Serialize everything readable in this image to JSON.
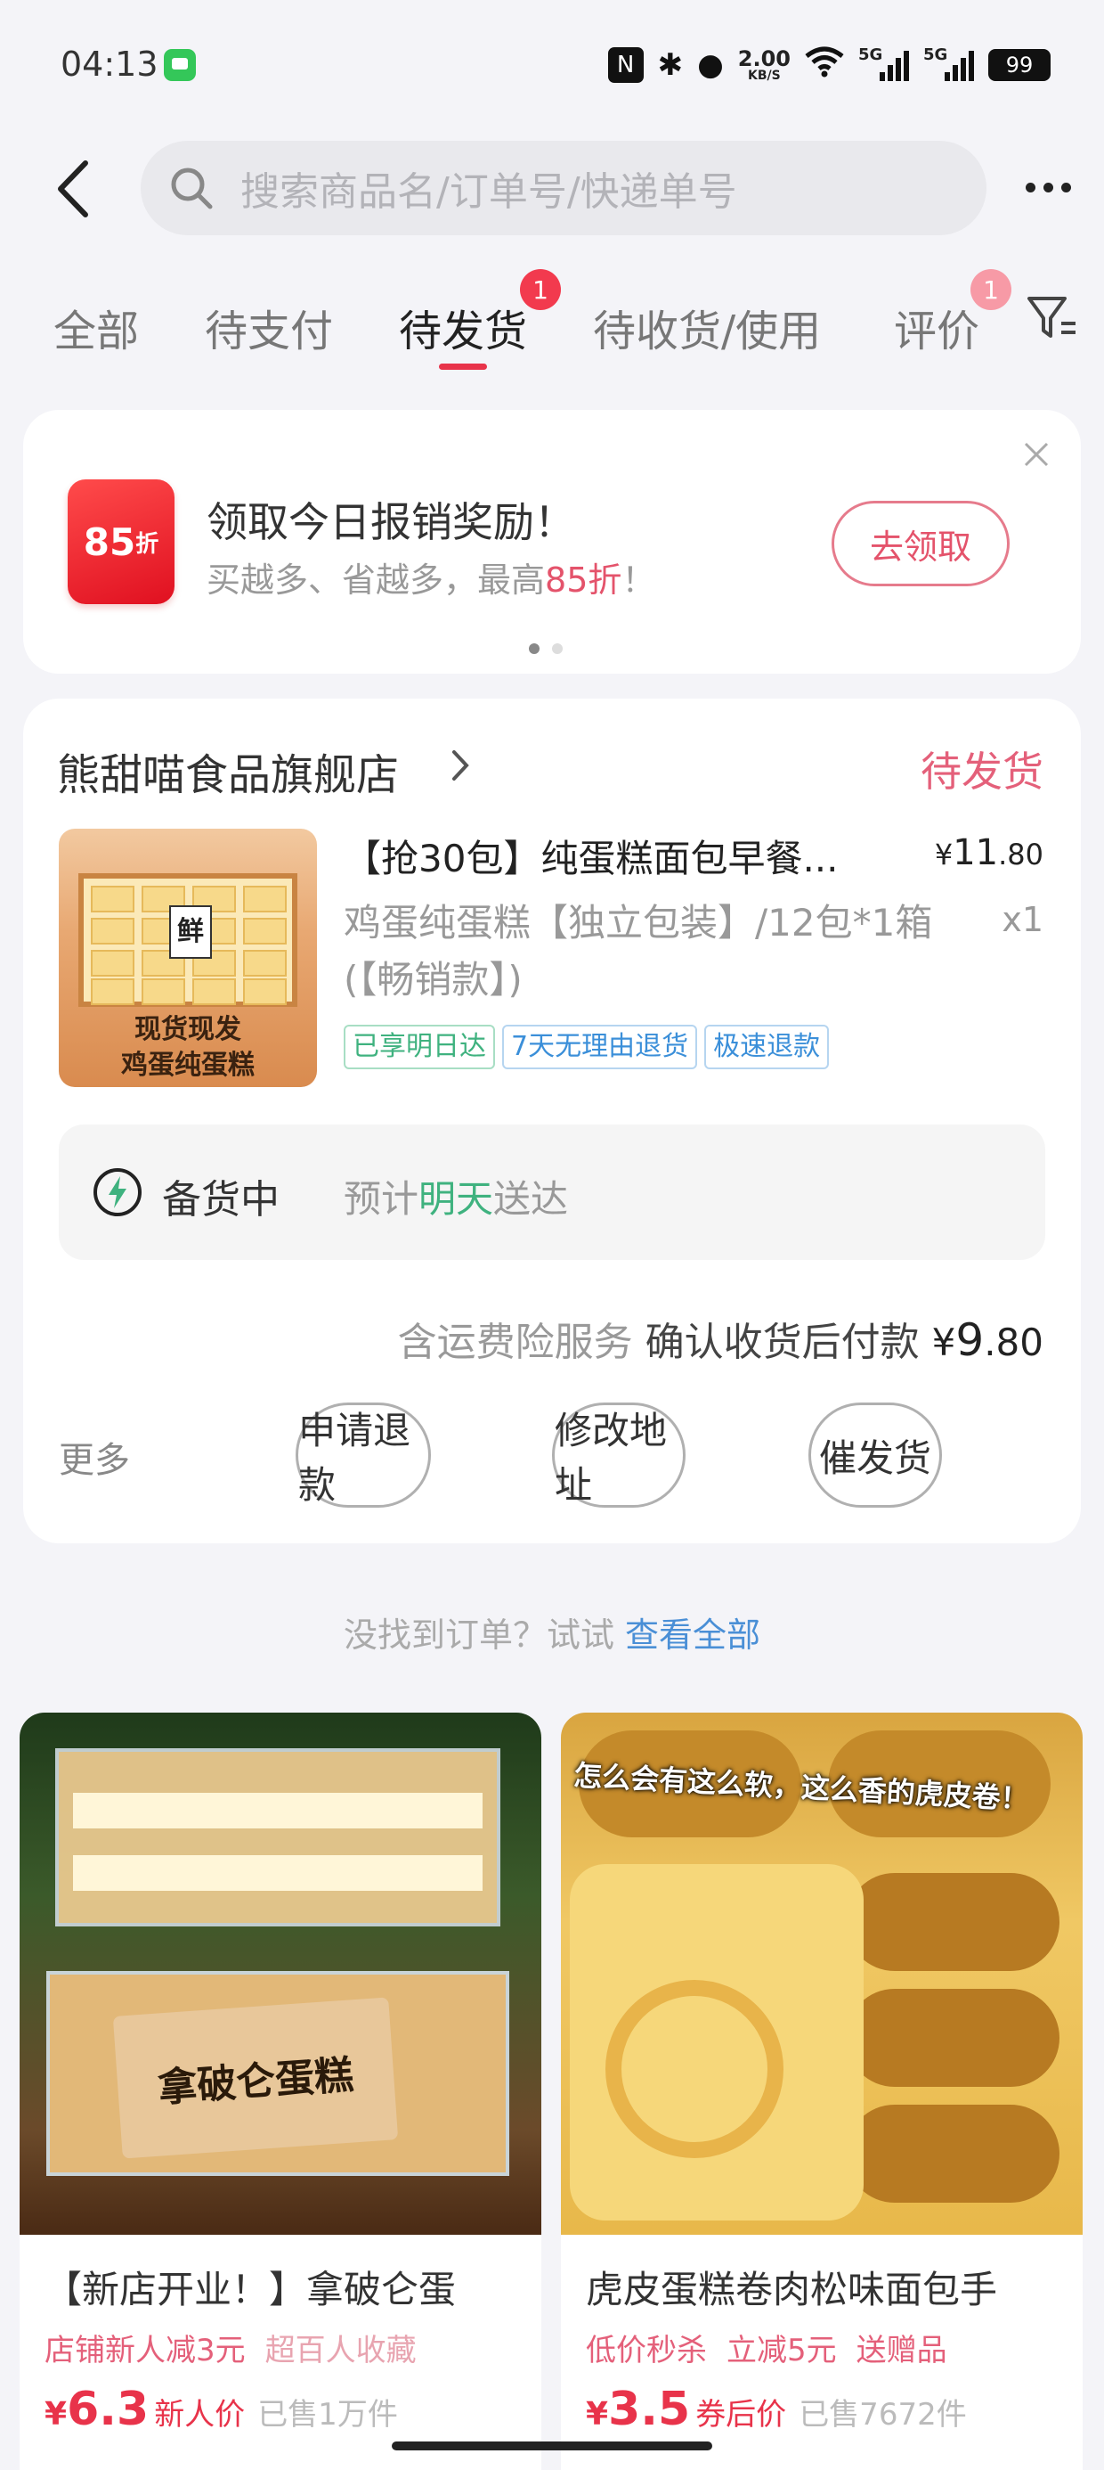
{
  "status_bar": {
    "time": "04:13",
    "speed_value": "2.00",
    "speed_unit": "KB/S",
    "signal1_label": "5G",
    "signal2_label": "5G",
    "battery": "99"
  },
  "search": {
    "placeholder": "搜索商品名/订单号/快递单号"
  },
  "tabs": [
    {
      "label": "全部"
    },
    {
      "label": "待支付"
    },
    {
      "label": "待发货",
      "badge": "1"
    },
    {
      "label": "待收货/使用"
    },
    {
      "label": "评价",
      "badge": "1"
    }
  ],
  "promo": {
    "badge_num": "85",
    "badge_unit": "折",
    "title": "领取今日报销奖励！",
    "subtitle_prefix": "买越多、省越多，最高",
    "subtitle_highlight": "85折",
    "subtitle_suffix": "！",
    "button": "去领取"
  },
  "order": {
    "shop_name": "熊甜喵食品旗舰店",
    "status": "待发货",
    "product_image_label1": "鲜",
    "product_image_label2": "现货现发",
    "product_image_label3": "鸡蛋纯蛋糕",
    "product_title": "【抢30包】纯蛋糕面包早餐...",
    "price_symbol": "¥",
    "price_int": "11",
    "price_dec": ".80",
    "spec": "鸡蛋纯蛋糕【独立包装】/12包*1箱(【畅销款】)",
    "quantity": "x1",
    "tags": [
      "已享明日达",
      "7天无理由退货",
      "极速退款"
    ],
    "ship_status": "备货中",
    "ship_eta_prefix": "预计",
    "ship_eta_highlight": "明天",
    "ship_eta_suffix": "送达",
    "pay_note": "含运费险服务",
    "pay_label": "确认收货后付款",
    "pay_symbol": "¥",
    "pay_int": "9",
    "pay_dec": ".80",
    "more": "更多",
    "btn_refund": "申请退款",
    "btn_address": "修改地址",
    "btn_urge": "催发货"
  },
  "not_found": {
    "text": "没找到订单？试试",
    "link": "查看全部"
  },
  "recommendations": [
    {
      "image_caption": "拿破仑蛋糕",
      "title": "【新店开业！】拿破仑蛋",
      "tags": [
        "店铺新人减3元",
        "超百人收藏"
      ],
      "currency": "¥",
      "price": "6.3",
      "price_label": "新人价",
      "sold": "已售1万件"
    },
    {
      "image_caption": "怎么会有这么软，这么香的虎皮卷！",
      "title": "虎皮蛋糕卷肉松味面包手",
      "tags": [
        "低价秒杀",
        "立减5元",
        "送赠品"
      ],
      "currency": "¥",
      "price": "3.5",
      "price_label": "券后价",
      "sold": "已售7672件"
    }
  ],
  "colors": {
    "accent": "#e8334a",
    "status_pink": "#e4607a",
    "green": "#3fb27f",
    "blue": "#3b8fd9"
  }
}
